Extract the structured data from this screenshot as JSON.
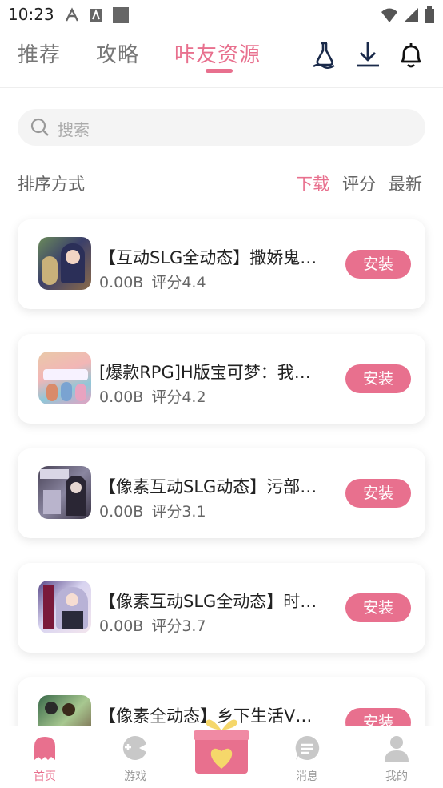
{
  "status_bar": {
    "time": "10:23"
  },
  "nav": {
    "tabs": [
      {
        "label": "推荐",
        "active": false
      },
      {
        "label": "攻略",
        "active": false
      },
      {
        "label": "咔友资源",
        "active": true
      }
    ],
    "icons": [
      "bottle-icon",
      "download-icon",
      "bell-icon"
    ]
  },
  "search": {
    "placeholder": "搜索"
  },
  "sort": {
    "label": "排序方式",
    "options": [
      {
        "label": "下载",
        "active": true
      },
      {
        "label": "评分",
        "active": false
      },
      {
        "label": "最新",
        "active": false
      }
    ]
  },
  "games": [
    {
      "title": "【互动SLG全动态】撒娇鬼…",
      "size": "0.00B",
      "rating": "评分4.4",
      "install": "安装"
    },
    {
      "title": "[爆款RPG]H版宝可梦：我…",
      "size": "0.00B",
      "rating": "评分4.2",
      "install": "安装"
    },
    {
      "title": "【像素互动SLG动态】污部…",
      "size": "0.00B",
      "rating": "评分3.1",
      "install": "安装"
    },
    {
      "title": "【像素互动SLG全动态】时…",
      "size": "0.00B",
      "rating": "评分3.7",
      "install": "安装"
    },
    {
      "title": "【像素全动态】乡下生活V…",
      "size": "",
      "rating": "",
      "install": "安装"
    }
  ],
  "bottom_nav": [
    {
      "label": "首页",
      "icon": "ghost-icon",
      "active": true
    },
    {
      "label": "游戏",
      "icon": "gamepad-icon",
      "active": false
    },
    {
      "label": "消息",
      "icon": "message-icon",
      "active": false
    },
    {
      "label": "我的",
      "icon": "person-icon",
      "active": false
    }
  ],
  "colors": {
    "accent": "#e8708e",
    "icon_gray": "#c8c8c8"
  }
}
